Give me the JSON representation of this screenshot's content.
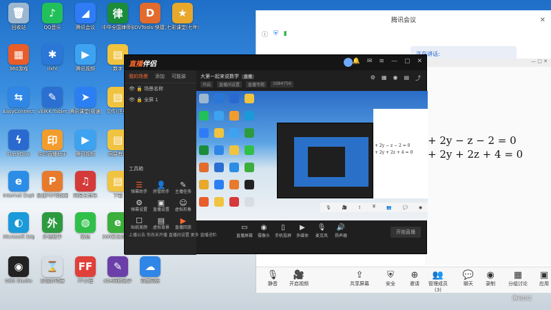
{
  "desktop_icons": [
    {
      "label": "回收站",
      "color": "#9cb7d0",
      "glyph": "🗑"
    },
    {
      "label": "QQ音乐",
      "color": "#22c05a",
      "glyph": "♪"
    },
    {
      "label": "腾讯会议",
      "color": "#2f7cf6",
      "glyph": "◢"
    },
    {
      "label": "中华全国律师协会网上培训平台",
      "color": "#1a8c3c",
      "glyph": "律"
    },
    {
      "label": "DVTools-快捷方式",
      "color": "#e26b2d",
      "glyph": "D"
    },
    {
      "label": "七彩课堂(七年级下)",
      "color": "#e7a82b",
      "glyph": "★"
    },
    {
      "label": "360游戏",
      "color": "#e85d2a",
      "glyph": "▦"
    },
    {
      "label": "ilxhl",
      "color": "#2a77d8",
      "glyph": "✱"
    },
    {
      "label": "腾讯视频",
      "color": "#3da3f0",
      "glyph": "▶"
    },
    {
      "label": "数字",
      "color": "#f0c340",
      "glyph": "▤"
    },
    {
      "label": "EasyConnect",
      "color": "#2f86e6",
      "glyph": "⇆"
    },
    {
      "label": "VEIKK Tablet",
      "color": "#2b6fd1",
      "glyph": "✎"
    },
    {
      "label": "腾讯课堂(极速版)",
      "color": "#2c7ff3",
      "glyph": "➤"
    },
    {
      "label": "文件(注册)",
      "color": "#f0c340",
      "glyph": "▤"
    },
    {
      "label": "FlashDisk",
      "color": "#2a6ad0",
      "glyph": "ϟ"
    },
    {
      "label": "华印直播助手",
      "color": "#f39c2e",
      "glyph": "印"
    },
    {
      "label": "腾讯视频",
      "color": "#3da3f0",
      "glyph": "▶"
    },
    {
      "label": "网易有道",
      "color": "#f0c340",
      "glyph": "▤"
    },
    {
      "label": "Internet Explorer",
      "color": "#2b8de6",
      "glyph": "e"
    },
    {
      "label": "极速PDF阅读器",
      "color": "#e87a2e",
      "glyph": "P"
    },
    {
      "label": "网易云音乐",
      "color": "#d53a3a",
      "glyph": "♫"
    },
    {
      "label": "下载",
      "color": "#f0c340",
      "glyph": "▤"
    },
    {
      "label": "Microsoft Edge",
      "color": "#1a9ad9",
      "glyph": "◐"
    },
    {
      "label": "外语助手",
      "color": "#2e9a40",
      "glyph": "外"
    },
    {
      "label": "微信",
      "color": "#30c04a",
      "glyph": "◍"
    },
    {
      "label": "360安全浏览器",
      "color": "#3cae3c",
      "glyph": "e"
    },
    {
      "label": "OBS Studio",
      "color": "#222222",
      "glyph": "◉"
    },
    {
      "label": "沙漏计时器",
      "color": "#d7dde4",
      "glyph": "⌛"
    },
    {
      "label": "FF小程",
      "color": "#e0403a",
      "glyph": "FF"
    },
    {
      "label": "d2e网格助手",
      "color": "#6b3fa8",
      "glyph": "✎"
    },
    {
      "label": "百度网盘",
      "color": "#2f86e6",
      "glyph": "☁"
    }
  ],
  "tencent_meeting": {
    "title": "腾讯会议",
    "speaking": "正在讲话:",
    "equations": [
      "+ 2y − z − 2 = 0",
      "+ 2y + 2z + 4 = 0"
    ],
    "toolbar": [
      {
        "label": "静音",
        "glyph": "🎙"
      },
      {
        "label": "开启视频",
        "glyph": "🎥"
      },
      {
        "label": "共享屏幕",
        "glyph": "⇪"
      },
      {
        "label": "安全",
        "glyph": "⛨"
      },
      {
        "label": "邀请",
        "glyph": "⊕"
      },
      {
        "label": "管理成员(3)",
        "glyph": "👥"
      },
      {
        "label": "聊天",
        "glyph": "💬"
      },
      {
        "label": "录制",
        "glyph": "◉"
      },
      {
        "label": "分组讨论",
        "glyph": "▦"
      },
      {
        "label": "应用",
        "glyph": "▣"
      }
    ],
    "footer_tag": "腾讯会议"
  },
  "zhibo": {
    "logo_prefix": "直播",
    "logo_suffix": "伴侣",
    "left_tabs": [
      "我的场景",
      "添加",
      "可能装"
    ],
    "scenes": [
      "场景名称",
      "全屏 1"
    ],
    "tools_heading": "工具箱",
    "tools": [
      {
        "label": "弹幕助手",
        "glyph": "☰",
        "accent": true
      },
      {
        "label": "房管助手",
        "glyph": "👤",
        "accent": false
      },
      {
        "label": "主播任务",
        "glyph": "✎",
        "accent": false
      },
      {
        "label": "弹幕设置",
        "glyph": "⚙",
        "accent": false
      },
      {
        "label": "直播设置",
        "glyph": "▣",
        "accent": false
      },
      {
        "label": "虚拟形象",
        "glyph": "☺",
        "accent": false
      },
      {
        "label": "贴纸美颜",
        "glyph": "☐",
        "accent": false
      },
      {
        "label": "虚拟背景",
        "glyph": "▤",
        "accent": false
      },
      {
        "label": "直播回放",
        "glyph": "▶",
        "accent": true
      }
    ],
    "footer": "上播公告   你尚未开播   直播间设置   更多   直播进阶",
    "room_title": "大第一起来说数学",
    "room_tag": "直播",
    "room_sub": [
      "开启",
      "直播间设置",
      "直播专题",
      "1684756"
    ],
    "bottom_buttons": [
      {
        "label": "直播屏幕",
        "glyph": "▭"
      },
      {
        "label": "摄像头",
        "glyph": "◉"
      },
      {
        "label": "手机投屏",
        "glyph": "▯"
      },
      {
        "label": "多媒体",
        "glyph": "▶"
      },
      {
        "label": "麦克风",
        "glyph": "🎙"
      },
      {
        "label": "扬声器",
        "glyph": "🔊"
      }
    ],
    "start_label": "开始直播"
  }
}
